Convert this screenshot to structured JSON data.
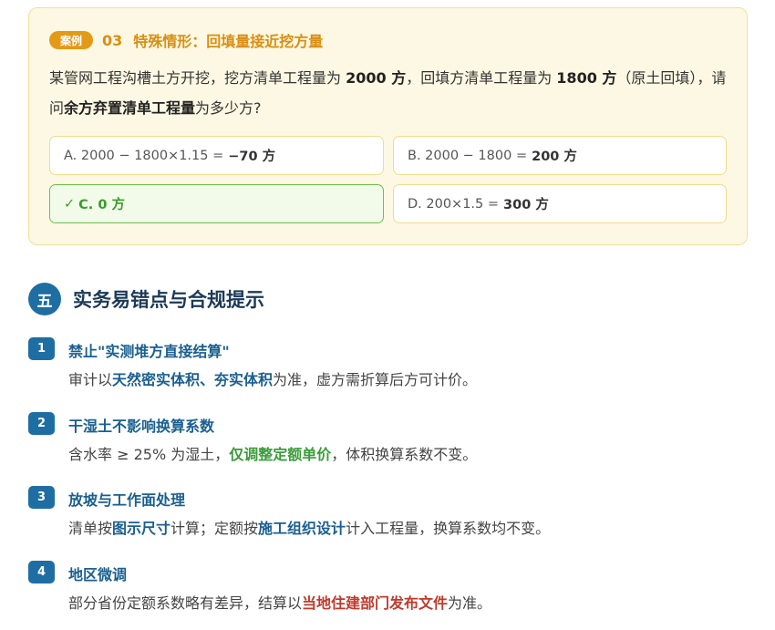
{
  "case": {
    "badge": "案例",
    "number": "03",
    "title": "特殊情形：回填量接近挖方量",
    "question": {
      "p1": "某管网工程沟槽土方开挖，挖方清单工程量为 ",
      "v1": "2000 方",
      "p2": "，回填方清单工程量为 ",
      "v2": "1800 方",
      "p3": "（原土回填），请问",
      "v3": "余方弃置清单工程量",
      "p4": "为多少方?"
    },
    "options": [
      {
        "expr": "A. 2000 − 1800×1.15 =",
        "result": "−70 方"
      },
      {
        "expr": "B. 2000 − 1800 =",
        "result": "200 方"
      },
      {
        "mark": "✓",
        "label": "C. 0 方"
      },
      {
        "expr": "D. 200×1.5 =",
        "result": "300 方"
      }
    ]
  },
  "section": {
    "number": "五",
    "title": "实务易错点与合规提示"
  },
  "tips": [
    {
      "num": "1",
      "title": "禁止\"实测堆方直接结算\"",
      "pre": "审计以",
      "hl": "天然密实体积、夯实体积",
      "post": "为准，虚方需折算后方可计价。"
    },
    {
      "num": "2",
      "title": "干湿土不影响换算系数",
      "pre": "含水率 ≥ 25% 为湿土，",
      "hl": "仅调整定额单价",
      "post": "，体积换算系数不变。"
    },
    {
      "num": "3",
      "title": "放坡与工作面处理",
      "pre": "清单按",
      "hl": "图示尺寸",
      "mid": "计算；定额按",
      "hl2": "施工组织设计",
      "post": "计入工程量，换算系数均不变。"
    },
    {
      "num": "4",
      "title": "地区微调",
      "pre": "部分省份定额系数略有差异，结算以",
      "hl": "当地住建部门发布文件",
      "post": "为准。"
    }
  ]
}
